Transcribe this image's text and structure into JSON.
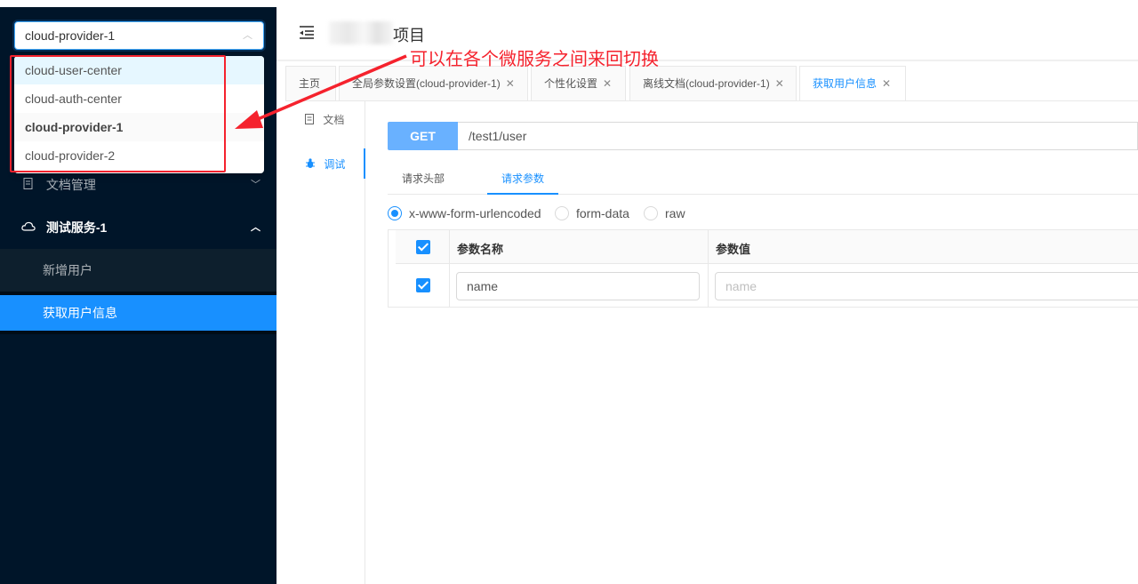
{
  "sidebar": {
    "service_select": "cloud-provider-1",
    "services": [
      "cloud-user-center",
      "cloud-auth-center",
      "cloud-provider-1",
      "cloud-provider-2"
    ],
    "menu": {
      "doc_manage": "文档管理",
      "test_service": "测试服务-1",
      "items": [
        "新增用户",
        "获取用户信息"
      ]
    }
  },
  "header": {
    "title": "项目"
  },
  "annotation": "可以在各个微服务之间来回切换",
  "tabs": [
    "主页",
    "全局参数设置(cloud-provider-1)",
    "个性化设置",
    "离线文档(cloud-provider-1)",
    "获取用户信息"
  ],
  "rail": {
    "doc": "文档",
    "debug": "调试"
  },
  "request": {
    "method": "GET",
    "url": "/test1/user",
    "subtabs": [
      "请求头部",
      "请求参数"
    ],
    "body_types": [
      "x-www-form-urlencoded",
      "form-data",
      "raw"
    ],
    "columns": [
      "参数名称",
      "参数值"
    ],
    "row": {
      "name": "name",
      "value_placeholder": "name"
    }
  },
  "colors": {
    "primary": "#1890ff",
    "sidebar": "#001529",
    "annotation": "#f5222d"
  }
}
